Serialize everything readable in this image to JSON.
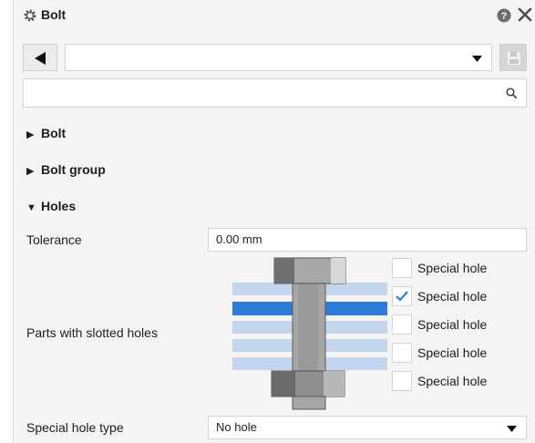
{
  "window": {
    "title": "Bolt"
  },
  "toolbar": {
    "settings_value": ""
  },
  "search": {
    "placeholder": "",
    "value": ""
  },
  "sections": {
    "bolt": {
      "label": "Bolt",
      "expanded": false
    },
    "bolt_group": {
      "label": "Bolt group",
      "expanded": false
    },
    "holes": {
      "label": "Holes",
      "expanded": true
    }
  },
  "holes": {
    "tolerance_label": "Tolerance",
    "tolerance_value": "0.00 mm",
    "slotted_label": "Parts with slotted holes",
    "special_holes": [
      {
        "label": "Special hole",
        "checked": false
      },
      {
        "label": "Special hole",
        "checked": true
      },
      {
        "label": "Special hole",
        "checked": false
      },
      {
        "label": "Special hole",
        "checked": false
      },
      {
        "label": "Special hole",
        "checked": false
      }
    ],
    "hole_type_label": "Special hole type",
    "hole_type_value": "No hole"
  },
  "colors": {
    "accent": "#2f7bd6",
    "plate": "#c4d6ee",
    "bolt_gray": "#a6a6a6"
  }
}
